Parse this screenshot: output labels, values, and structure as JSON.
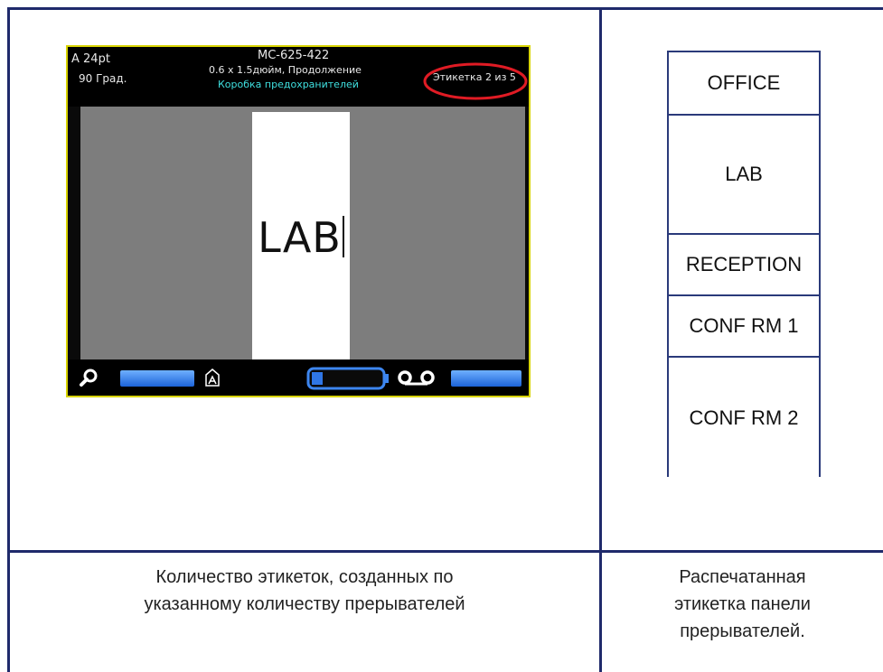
{
  "device_screen": {
    "font_size": "A 24pt",
    "rotation": "90 Град.",
    "part_number": "MC-625-422",
    "label_size": "0.6 x 1.5дюйм, Продолжение",
    "mode": "Коробка предохранителей",
    "label_counter": "Этикетка 2 из 5",
    "label_text": "LAB",
    "icons": [
      "magnifier-icon",
      "lock-icon",
      "battery-icon",
      "ribbon-icon"
    ],
    "colors": {
      "highlight": "#e01b24",
      "mode_text": "#3fe0e0",
      "frame": "#d8d400"
    }
  },
  "printed_label": {
    "cells": [
      "OFFICE",
      "LAB",
      "RECEPTION",
      "CONF RM 1",
      "CONF RM 2"
    ]
  },
  "captions": {
    "left_line1": "Количество этикеток, созданных по",
    "left_line2": "указанному количеству прерывателей",
    "right_line1": "Распечатанная",
    "right_line2": "этикетка панели",
    "right_line3": "прерывателей."
  }
}
